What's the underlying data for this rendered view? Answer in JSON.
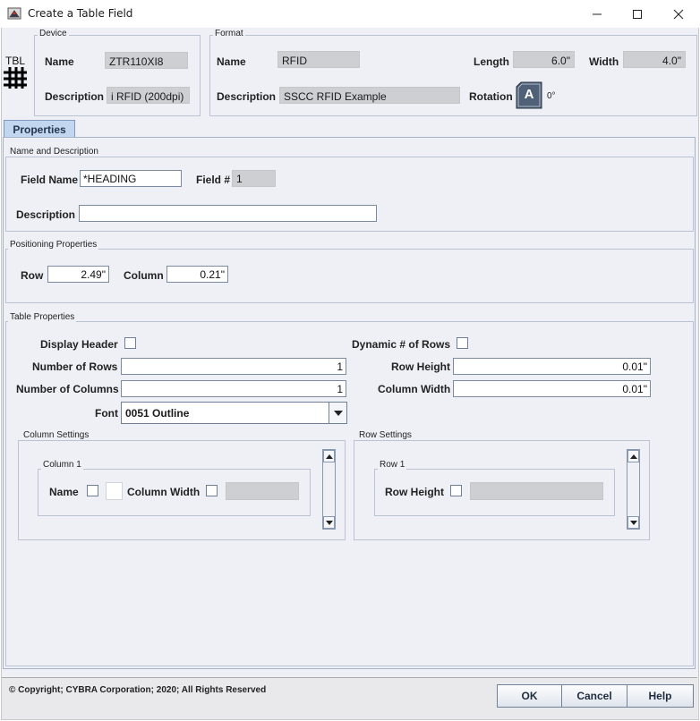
{
  "window": {
    "title": "Create a Table Field",
    "minimize_icon": "minimize-icon",
    "maximize_icon": "maximize-icon",
    "close_icon": "close-icon"
  },
  "logo": {
    "text": "TBL",
    "icon": "table-grid-icon"
  },
  "device": {
    "group_title": "Device",
    "name_label": "Name",
    "name_value": "ZTR110XI8",
    "description_label": "Description",
    "description_value": "i RFID (200dpi)"
  },
  "format": {
    "group_title": "Format",
    "name_label": "Name",
    "name_value": "RFID",
    "length_label": "Length",
    "length_value": "6.0\"",
    "width_label": "Width",
    "width_value": "4.0\"",
    "description_label": "Description",
    "description_value": "SSCC RFID Example",
    "rotation_label": "Rotation",
    "rotation_glyph": "A",
    "rotation_value": "0°"
  },
  "tabs": [
    {
      "label": "Properties"
    }
  ],
  "name_desc": {
    "group_title": "Name and Description",
    "field_name_label": "Field Name",
    "field_name_value": "*HEADING",
    "field_num_label": "Field #",
    "field_num_value": "1",
    "description_label": "Description",
    "description_value": ""
  },
  "positioning": {
    "group_title": "Positioning Properties",
    "row_label": "Row",
    "row_value": "2.49\"",
    "column_label": "Column",
    "column_value": "0.21\""
  },
  "table_props": {
    "group_title": "Table Properties",
    "display_header_label": "Display Header",
    "dynamic_rows_label": "Dynamic # of Rows",
    "num_rows_label": "Number of Rows",
    "num_rows_value": "1",
    "row_height_label": "Row Height",
    "row_height_value": "0.01\"",
    "num_columns_label": "Number of Columns",
    "num_columns_value": "1",
    "column_width_label": "Column Width",
    "column_width_value": "0.01\"",
    "font_label": "Font",
    "font_value": "0051 Outline"
  },
  "column_settings": {
    "group_title": "Column Settings",
    "item_title": "Column 1",
    "name_label": "Name",
    "column_width_label": "Column Width"
  },
  "row_settings": {
    "group_title": "Row Settings",
    "item_title": "Row 1",
    "row_height_label": "Row Height"
  },
  "footer": {
    "copyright": "© Copyright; CYBRA Corporation; 2020; All Rights Reserved",
    "ok_label": "OK",
    "cancel_label": "Cancel",
    "help_label": "Help"
  },
  "colors": {
    "panel_bg": "#eef0f6",
    "tab_bg": "#c3d6ef",
    "readonly_bg": "#cdcfd3"
  }
}
